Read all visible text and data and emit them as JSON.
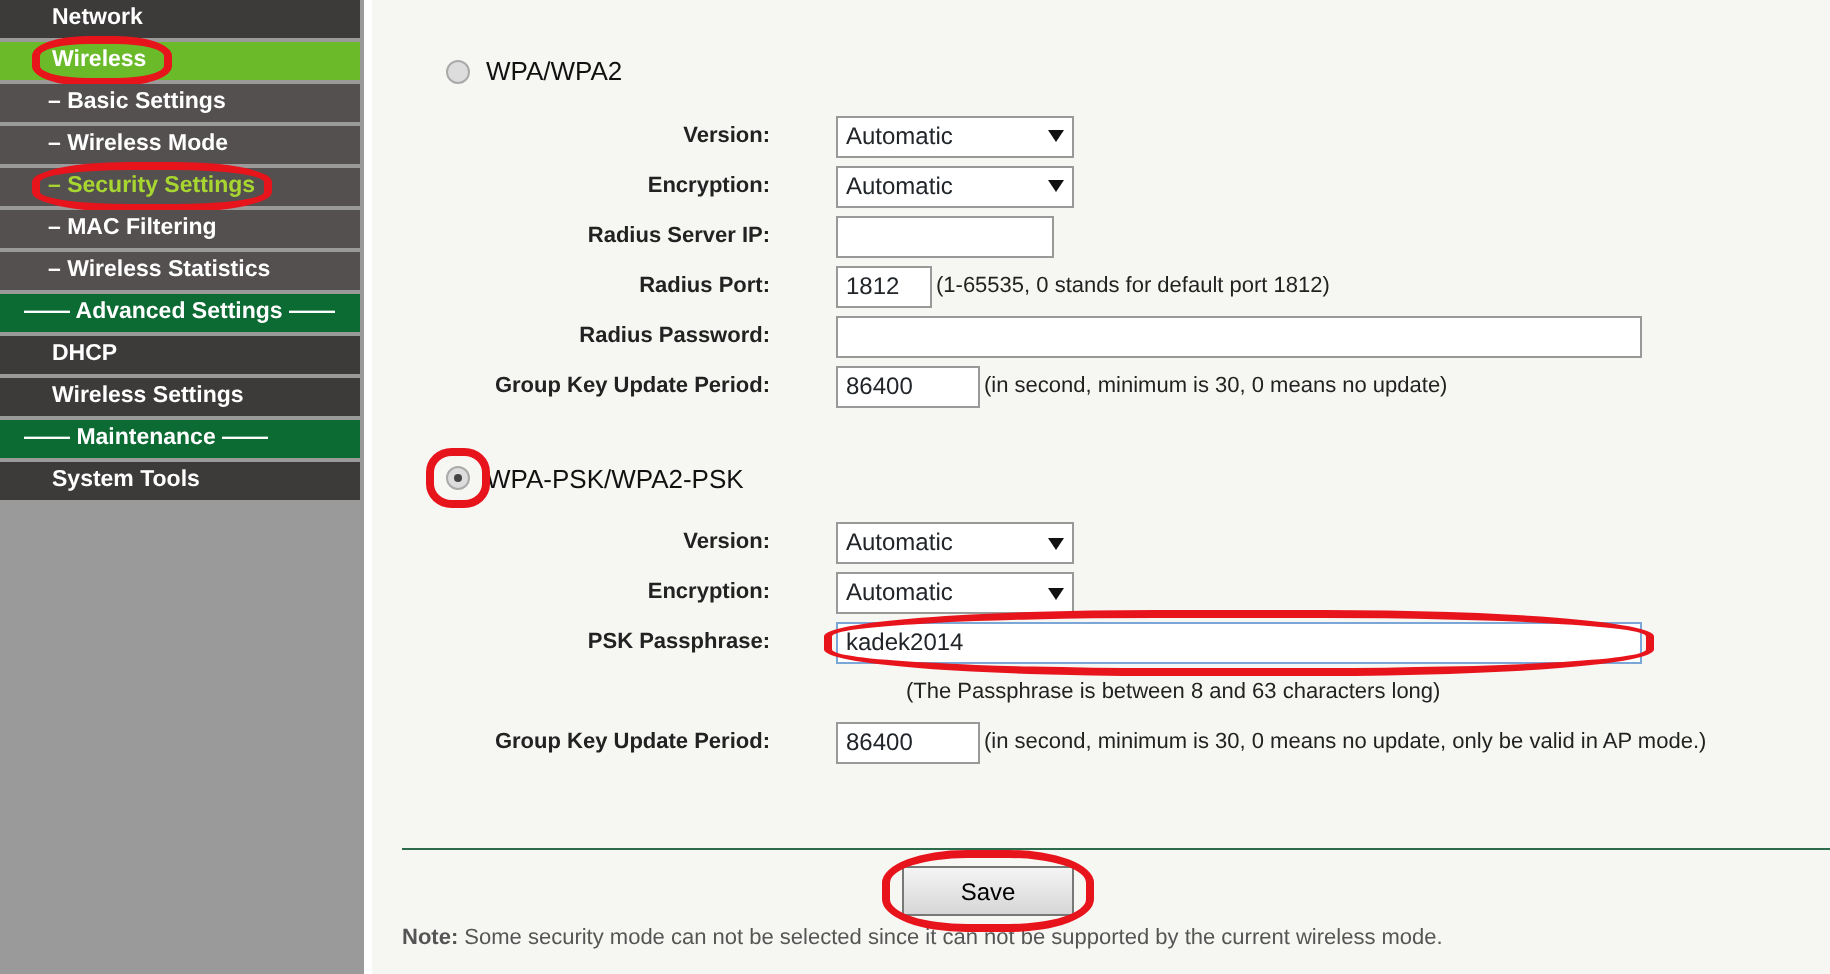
{
  "sidebar": {
    "items": [
      {
        "label": "Network",
        "kind": "item",
        "selected": false,
        "circled": false
      },
      {
        "label": "Wireless",
        "kind": "item",
        "selected": true,
        "circled": true
      },
      {
        "label": "– Basic Settings",
        "kind": "sub",
        "selected": false,
        "circled": false
      },
      {
        "label": "– Wireless Mode",
        "kind": "sub",
        "selected": false,
        "circled": false
      },
      {
        "label": "– Security Settings",
        "kind": "sub",
        "selected": true,
        "circled": true
      },
      {
        "label": "– MAC Filtering",
        "kind": "sub",
        "selected": false,
        "circled": false
      },
      {
        "label": "– Wireless Statistics",
        "kind": "sub",
        "selected": false,
        "circled": false
      },
      {
        "label": "—— Advanced Settings ——",
        "kind": "header",
        "selected": false,
        "circled": false
      },
      {
        "label": "DHCP",
        "kind": "item",
        "selected": false,
        "circled": false
      },
      {
        "label": "Wireless Settings",
        "kind": "item",
        "selected": false,
        "circled": false
      },
      {
        "label": "—— Maintenance ——",
        "kind": "header",
        "selected": false,
        "circled": false
      },
      {
        "label": "System Tools",
        "kind": "item",
        "selected": false,
        "circled": false
      }
    ]
  },
  "sections": [
    {
      "title": "WPA/WPA2",
      "selected": false,
      "circled": false,
      "fields": [
        {
          "label": "Version:",
          "kind": "select",
          "value": "Automatic"
        },
        {
          "label": "Encryption:",
          "kind": "select",
          "value": "Automatic"
        },
        {
          "label": "Radius Server IP:",
          "kind": "input"
        },
        {
          "label": "Radius Port:",
          "kind": "short-input",
          "value": "1812",
          "hint": "(1-65535, 0 stands for default port 1812)"
        },
        {
          "label": "Radius Password:",
          "kind": "wide-input"
        },
        {
          "label": "Group Key Update Period:",
          "kind": "medium-input",
          "value": "86400",
          "hint": "(in second, minimum is 30, 0 means no update)"
        }
      ]
    },
    {
      "title": "WPA-PSK/WPA2-PSK",
      "selected": true,
      "circled": true,
      "fields": [
        {
          "label": "Version:",
          "kind": "select",
          "value": "Automatic"
        },
        {
          "label": "Encryption:",
          "kind": "select",
          "value": "Automatic"
        },
        {
          "label": "PSK Passphrase:",
          "kind": "wide-input",
          "value": "kadek2014",
          "focused": true,
          "circled": true
        },
        {
          "kind": "note",
          "hint": "(The Passphrase is between 8 and 63 characters long)"
        },
        {
          "label": "Group Key Update Period:",
          "kind": "medium-input",
          "value": "86400",
          "hint": "(in second, minimum is 30, 0 means no update, only be valid in AP mode.)"
        }
      ]
    }
  ],
  "save_button": {
    "label": "Save",
    "circled": true
  },
  "note": "**Note:** Some security mode can not be selected since it can not be supported by the current wireless mode."
}
